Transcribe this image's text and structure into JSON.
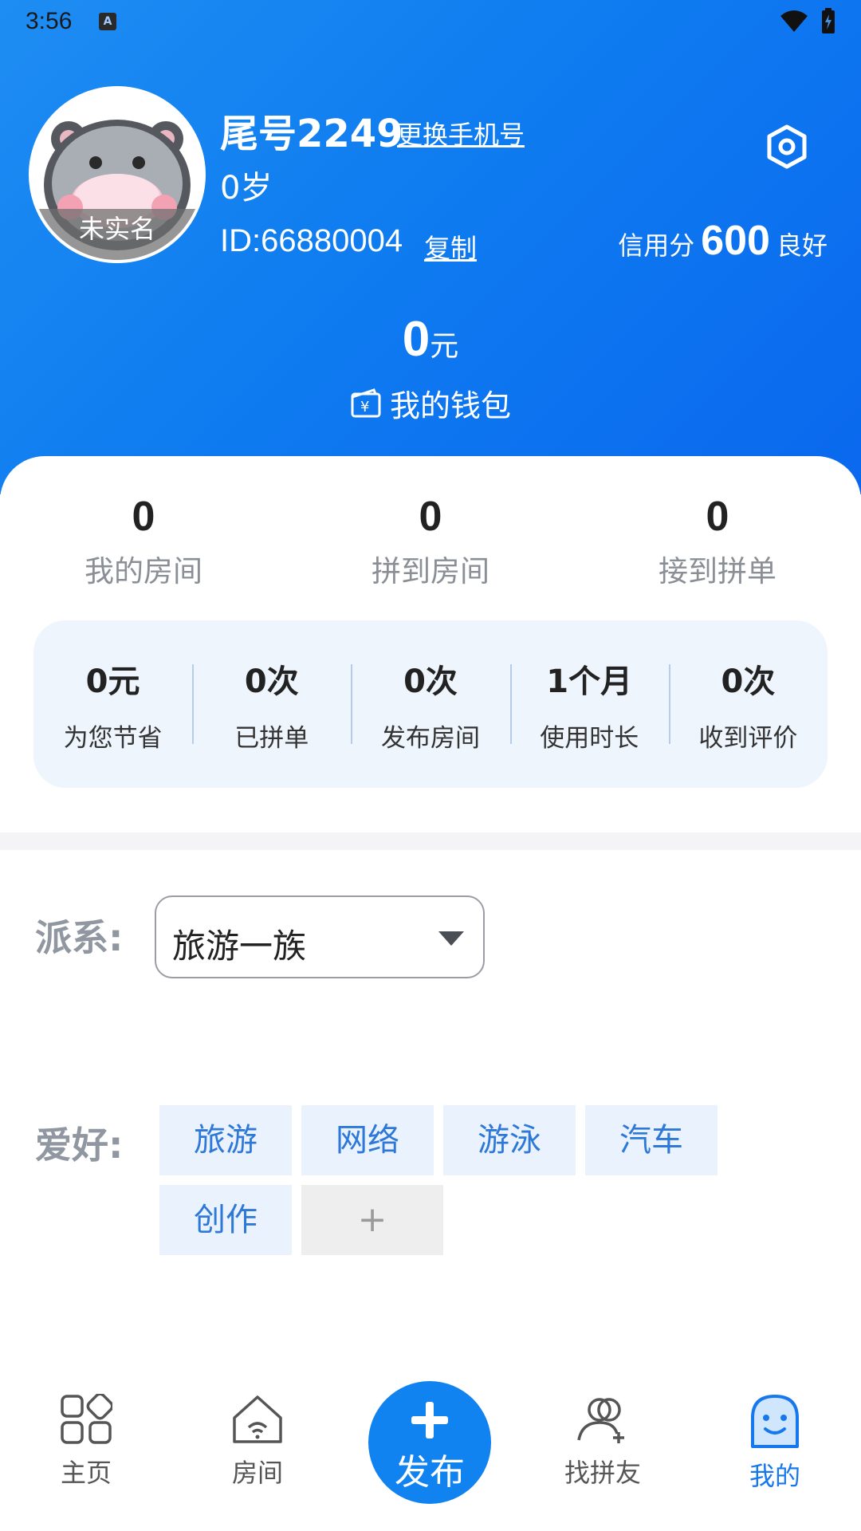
{
  "status_bar": {
    "time": "3:56",
    "notification_icon": "a-badge-icon"
  },
  "profile": {
    "nickname": "尾号2249",
    "change_phone": "更换手机号",
    "age": "0岁",
    "id_text": "ID:66880004",
    "copy": "复制",
    "avatar_badge": "未实名",
    "credit_label": "信用分",
    "credit_score": "600",
    "credit_level": "良好"
  },
  "wallet": {
    "amount": "0",
    "unit": "元",
    "label": "我的钱包"
  },
  "stats": [
    {
      "value": "0",
      "label": "我的房间"
    },
    {
      "value": "0",
      "label": "拼到房间"
    },
    {
      "value": "0",
      "label": "接到拼单"
    }
  ],
  "summary": [
    {
      "value": "0元",
      "label": "为您节省"
    },
    {
      "value": "0次",
      "label": "已拼单"
    },
    {
      "value": "0次",
      "label": "发布房间"
    },
    {
      "value": "1个月",
      "label": "使用时长"
    },
    {
      "value": "0次",
      "label": "收到评价"
    }
  ],
  "faction": {
    "label": "派系:",
    "value": "旅游一族"
  },
  "hobbies": {
    "label": "爱好:",
    "tags": [
      "旅游",
      "网络",
      "游泳",
      "汽车",
      "创作"
    ],
    "add": "+"
  },
  "tabs": [
    {
      "label": "主页",
      "icon": "grid-icon"
    },
    {
      "label": "房间",
      "icon": "house-icon"
    },
    {
      "label": "发布",
      "icon": "plus-icon"
    },
    {
      "label": "找拼友",
      "icon": "add-friend-icon"
    },
    {
      "label": "我的",
      "icon": "profile-ghost-icon"
    }
  ],
  "colors": {
    "primary": "#1183f1",
    "header_start": "#1e8df2",
    "header_end": "#0a68ee",
    "tag_bg": "#eaf3fd",
    "tag_text": "#2e78d8"
  }
}
